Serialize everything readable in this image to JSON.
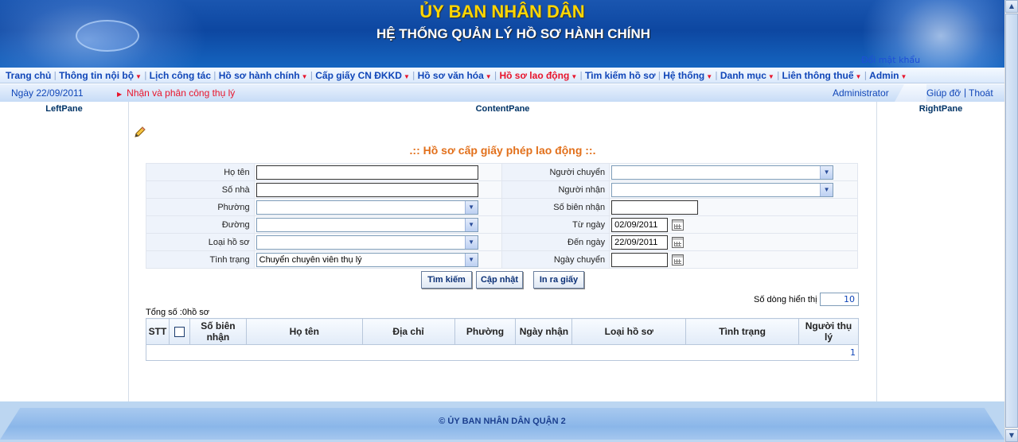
{
  "header": {
    "title_line1": "ỦY BAN NHÂN DÂN",
    "title_line2": "HỆ THỐNG QUẢN LÝ HỒ SƠ HÀNH CHÍNH",
    "change_password": "Đổi mật khẩu"
  },
  "menu": [
    {
      "label": "Trang chủ",
      "arrow": false
    },
    {
      "label": "Thông tin nội bộ",
      "arrow": true
    },
    {
      "label": "Lịch công tác",
      "arrow": false
    },
    {
      "label": "Hồ sơ hành chính",
      "arrow": true
    },
    {
      "label": "Cấp giấy CN ĐKKD",
      "arrow": true
    },
    {
      "label": "Hồ sơ văn hóa",
      "arrow": true
    },
    {
      "label": "Hồ sơ lao động",
      "arrow": true,
      "active": true
    },
    {
      "label": "Tìm kiếm hồ sơ",
      "arrow": false
    },
    {
      "label": "Hệ thống",
      "arrow": true
    },
    {
      "label": "Danh mục",
      "arrow": true
    },
    {
      "label": "Liên thông thuế",
      "arrow": true
    },
    {
      "label": "Admin",
      "arrow": true
    }
  ],
  "infobar": {
    "date": "Ngày 22/09/2011",
    "breadcrumb": "Nhận và phân công thụ lý",
    "user": "Administrator",
    "help": "Giúp đỡ",
    "separator": "|",
    "logout": "Thoát"
  },
  "panes": {
    "left": "LeftPane",
    "content": "ContentPane",
    "right": "RightPane"
  },
  "form": {
    "title": ".:: Hồ sơ cấp giấy phép lao động ::.",
    "labels": {
      "ho_ten": "Họ tên",
      "so_nha": "Số nhà",
      "phuong": "Phường",
      "duong": "Đường",
      "loai_ho_so": "Loại hồ sơ",
      "tinh_trang": "Tình trạng",
      "nguoi_chuyen": "Người chuyển",
      "nguoi_nhan": "Người nhận",
      "so_bien_nhan": "Số biên nhận",
      "tu_ngay": "Từ ngày",
      "den_ngay": "Đến ngày",
      "ngay_chuyen": "Ngày chuyển"
    },
    "values": {
      "ho_ten": "",
      "so_nha": "",
      "phuong": "",
      "duong": "",
      "loai_ho_so": "",
      "tinh_trang": "Chuyển chuyên viên thụ lý",
      "nguoi_chuyen": "",
      "nguoi_nhan": "",
      "so_bien_nhan": "",
      "tu_ngay": "02/09/2011",
      "den_ngay": "22/09/2011",
      "ngay_chuyen": ""
    }
  },
  "buttons": {
    "search": "Tìm kiếm",
    "update": "Cập nhật",
    "print": "In ra giấy"
  },
  "results": {
    "rows_label": "Số dòng hiển thị",
    "rows_value": "10",
    "total": "Tổng số :0hồ sơ",
    "columns": [
      "STT",
      "",
      "Số biên nhận",
      "Họ tên",
      "Địa chỉ",
      "Phường",
      "Ngày nhận",
      "Loại hồ sơ",
      "Tình trạng",
      "Người thụ lý"
    ],
    "page": "1"
  },
  "footer": {
    "copyright": "© ỦY BAN NHÂN DÂN QUẬN 2"
  },
  "icons": {
    "edit": "pencil-icon",
    "calendar": "calendar-icon",
    "dropdown": "chevron-down-icon"
  },
  "colors": {
    "banner": "#0d47a1",
    "title_yellow": "#ffd600",
    "menu_link": "#1046b8",
    "active_red": "#e8142b",
    "form_title_orange": "#e2701b"
  }
}
